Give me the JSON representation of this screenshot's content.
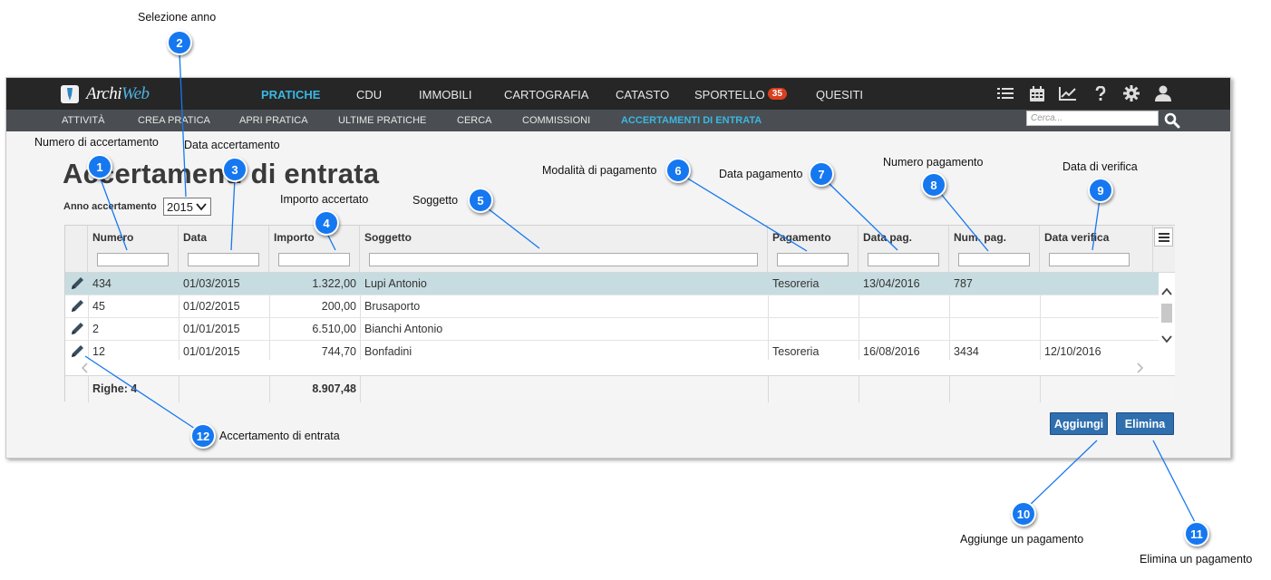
{
  "app": {
    "logo_prefix": "Archi",
    "logo_suffix": "Web",
    "nav": [
      "PRATICHE",
      "CDU",
      "IMMOBILI",
      "CARTOGRAFIA",
      "CATASTO",
      "SPORTELLO",
      "QUESITI"
    ],
    "nav_active": "PRATICHE",
    "sportello_badge": "35",
    "toolbar_icons": [
      "list-icon",
      "calendar-icon",
      "chart-icon",
      "help-icon",
      "gear-icon",
      "user-icon"
    ],
    "subnav": [
      "ATTIVITÀ",
      "CREA PRATICA",
      "APRI PRATICA",
      "ULTIME PRATICHE",
      "CERCA",
      "COMMISSIONI",
      "ACCERTAMENTI DI ENTRATA"
    ],
    "subnav_active": "ACCERTAMENTI DI ENTRATA",
    "search_placeholder": "Cerca...",
    "accent_color": "#3ab7e2"
  },
  "page": {
    "title": "Accertamenti di entrata",
    "year_label": "Anno accertamento",
    "year_value": "2015"
  },
  "grid": {
    "columns": [
      "Numero",
      "Data",
      "Importo",
      "Soggetto",
      "Pagamento",
      "Data pag.",
      "Num. pag.",
      "Data verifica"
    ],
    "rows": [
      {
        "numero": "434",
        "data": "01/03/2015",
        "importo": "1.322,00",
        "soggetto": "Lupi Antonio",
        "pagamento": "Tesoreria",
        "data_pag": "13/04/2016",
        "num_pag": "787",
        "data_verifica": "",
        "selected": true
      },
      {
        "numero": "45",
        "data": "01/02/2015",
        "importo": "200,00",
        "soggetto": "Brusaporto",
        "pagamento": "",
        "data_pag": "",
        "num_pag": "",
        "data_verifica": "",
        "selected": false
      },
      {
        "numero": "2",
        "data": "01/01/2015",
        "importo": "6.510,00",
        "soggetto": "Bianchi Antonio",
        "pagamento": "",
        "data_pag": "",
        "num_pag": "",
        "data_verifica": "",
        "selected": false
      },
      {
        "numero": "12",
        "data": "01/01/2015",
        "importo": "744,70",
        "soggetto": "Bonfadini",
        "pagamento": "Tesoreria",
        "data_pag": "16/08/2016",
        "num_pag": "3434",
        "data_verifica": "12/10/2016",
        "selected": false
      }
    ],
    "footer_rows": "Righe: 4",
    "footer_total": "8.907,48",
    "selected_row_color": "#c6dce0"
  },
  "buttons": {
    "add": "Aggiungi",
    "delete": "Elimina",
    "color": "#2f6fae"
  },
  "annotations": [
    {
      "num": "1",
      "label": "Numero di accertamento"
    },
    {
      "num": "2",
      "label": "Selezione anno"
    },
    {
      "num": "3",
      "label": "Data accertamento"
    },
    {
      "num": "4",
      "label": "Importo accertato"
    },
    {
      "num": "5",
      "label": "Soggetto"
    },
    {
      "num": "6",
      "label": "Modalità di pagamento"
    },
    {
      "num": "7",
      "label": "Data pagamento"
    },
    {
      "num": "8",
      "label": "Numero pagamento"
    },
    {
      "num": "9",
      "label": "Data di verifica"
    },
    {
      "num": "10",
      "label": "Aggiunge un pagamento"
    },
    {
      "num": "11",
      "label": "Elimina un pagamento"
    },
    {
      "num": "12",
      "label": "Accertamento di entrata"
    }
  ],
  "annotation_color": "#1678f0"
}
